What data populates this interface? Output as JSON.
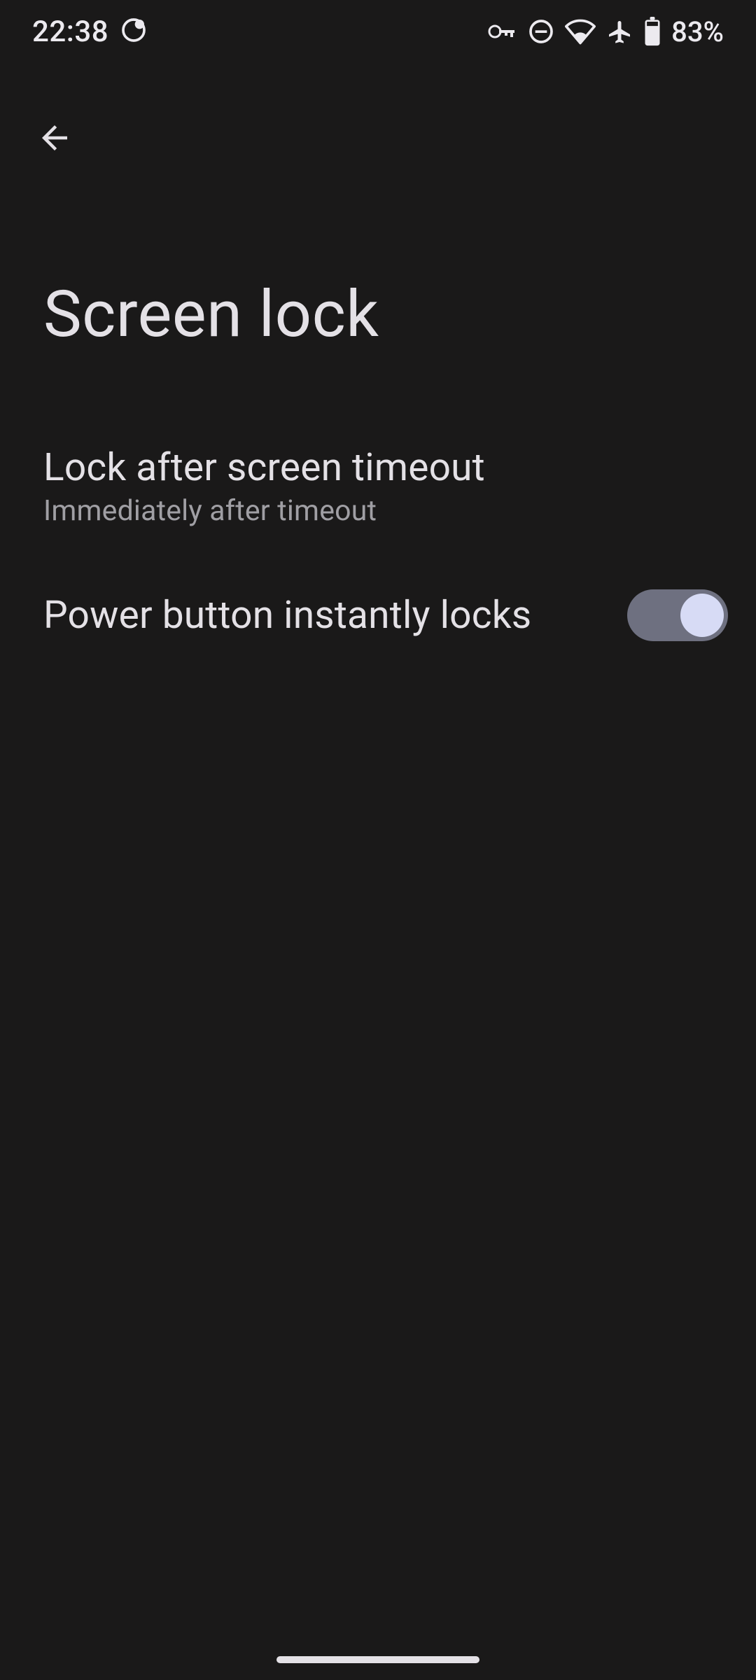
{
  "status": {
    "time": "22:38",
    "battery_percent": "83%"
  },
  "page": {
    "title": "Screen lock"
  },
  "settings": {
    "lock_after": {
      "title": "Lock after screen timeout",
      "subtitle": "Immediately after timeout"
    },
    "power_locks": {
      "title": "Power button instantly locks",
      "enabled": true
    }
  }
}
